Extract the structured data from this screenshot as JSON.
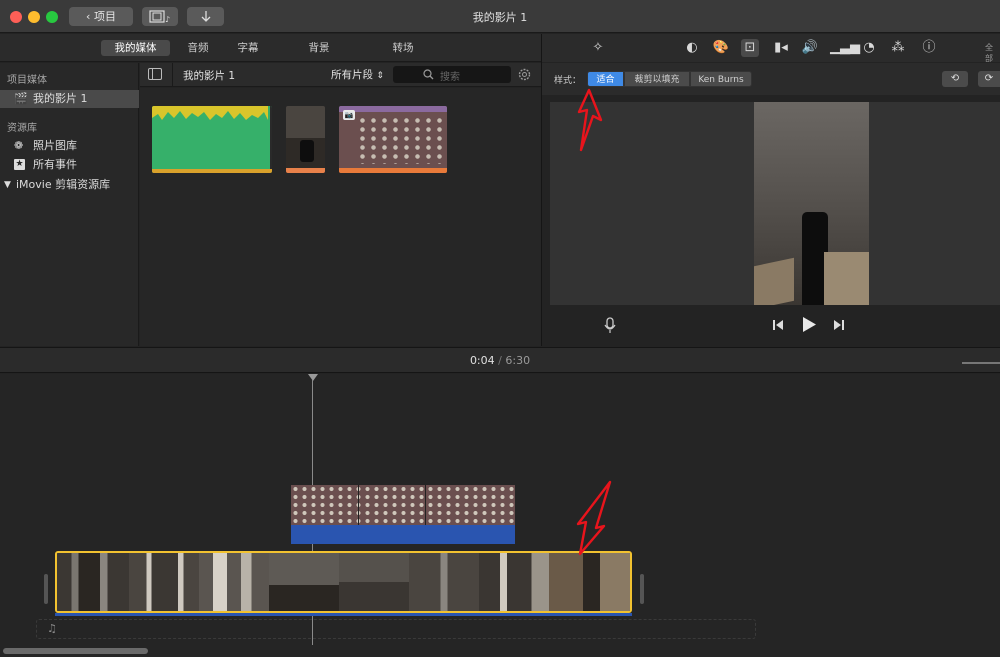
{
  "window": {
    "title": "我的影片 1",
    "back_label": "项目",
    "colors": {
      "close": "#fe5f57",
      "minimize": "#febc2e",
      "zoom": "#28c840",
      "accent": "#3f8ae6",
      "annotation": "#e8141c"
    }
  },
  "media_tabs": [
    {
      "label": "我的媒体",
      "active": true
    },
    {
      "label": "音频",
      "active": false
    },
    {
      "label": "字幕",
      "active": false
    },
    {
      "label": "背景",
      "active": false
    },
    {
      "label": "转场",
      "active": false
    }
  ],
  "sidebar": {
    "section1": "项目媒体",
    "project_item": "我的影片 1",
    "section2": "资源库",
    "items": [
      {
        "label": "照片图库",
        "icon": "flower-icon"
      },
      {
        "label": "所有事件",
        "icon": "star-icon"
      }
    ],
    "library": "iMovie 剪辑资源库"
  },
  "browser": {
    "title": "我的影片 1",
    "filter": "所有片段",
    "search_placeholder": "搜索"
  },
  "viewer": {
    "style_label": "样式：",
    "styles": [
      {
        "label": "适合",
        "active": true
      },
      {
        "label": "裁剪以填充",
        "active": false
      },
      {
        "label": "Ken Burns",
        "active": false
      }
    ],
    "right_label": "全部"
  },
  "timeline": {
    "current_time": "0:04",
    "separator": "/",
    "total_time": "6:30"
  }
}
